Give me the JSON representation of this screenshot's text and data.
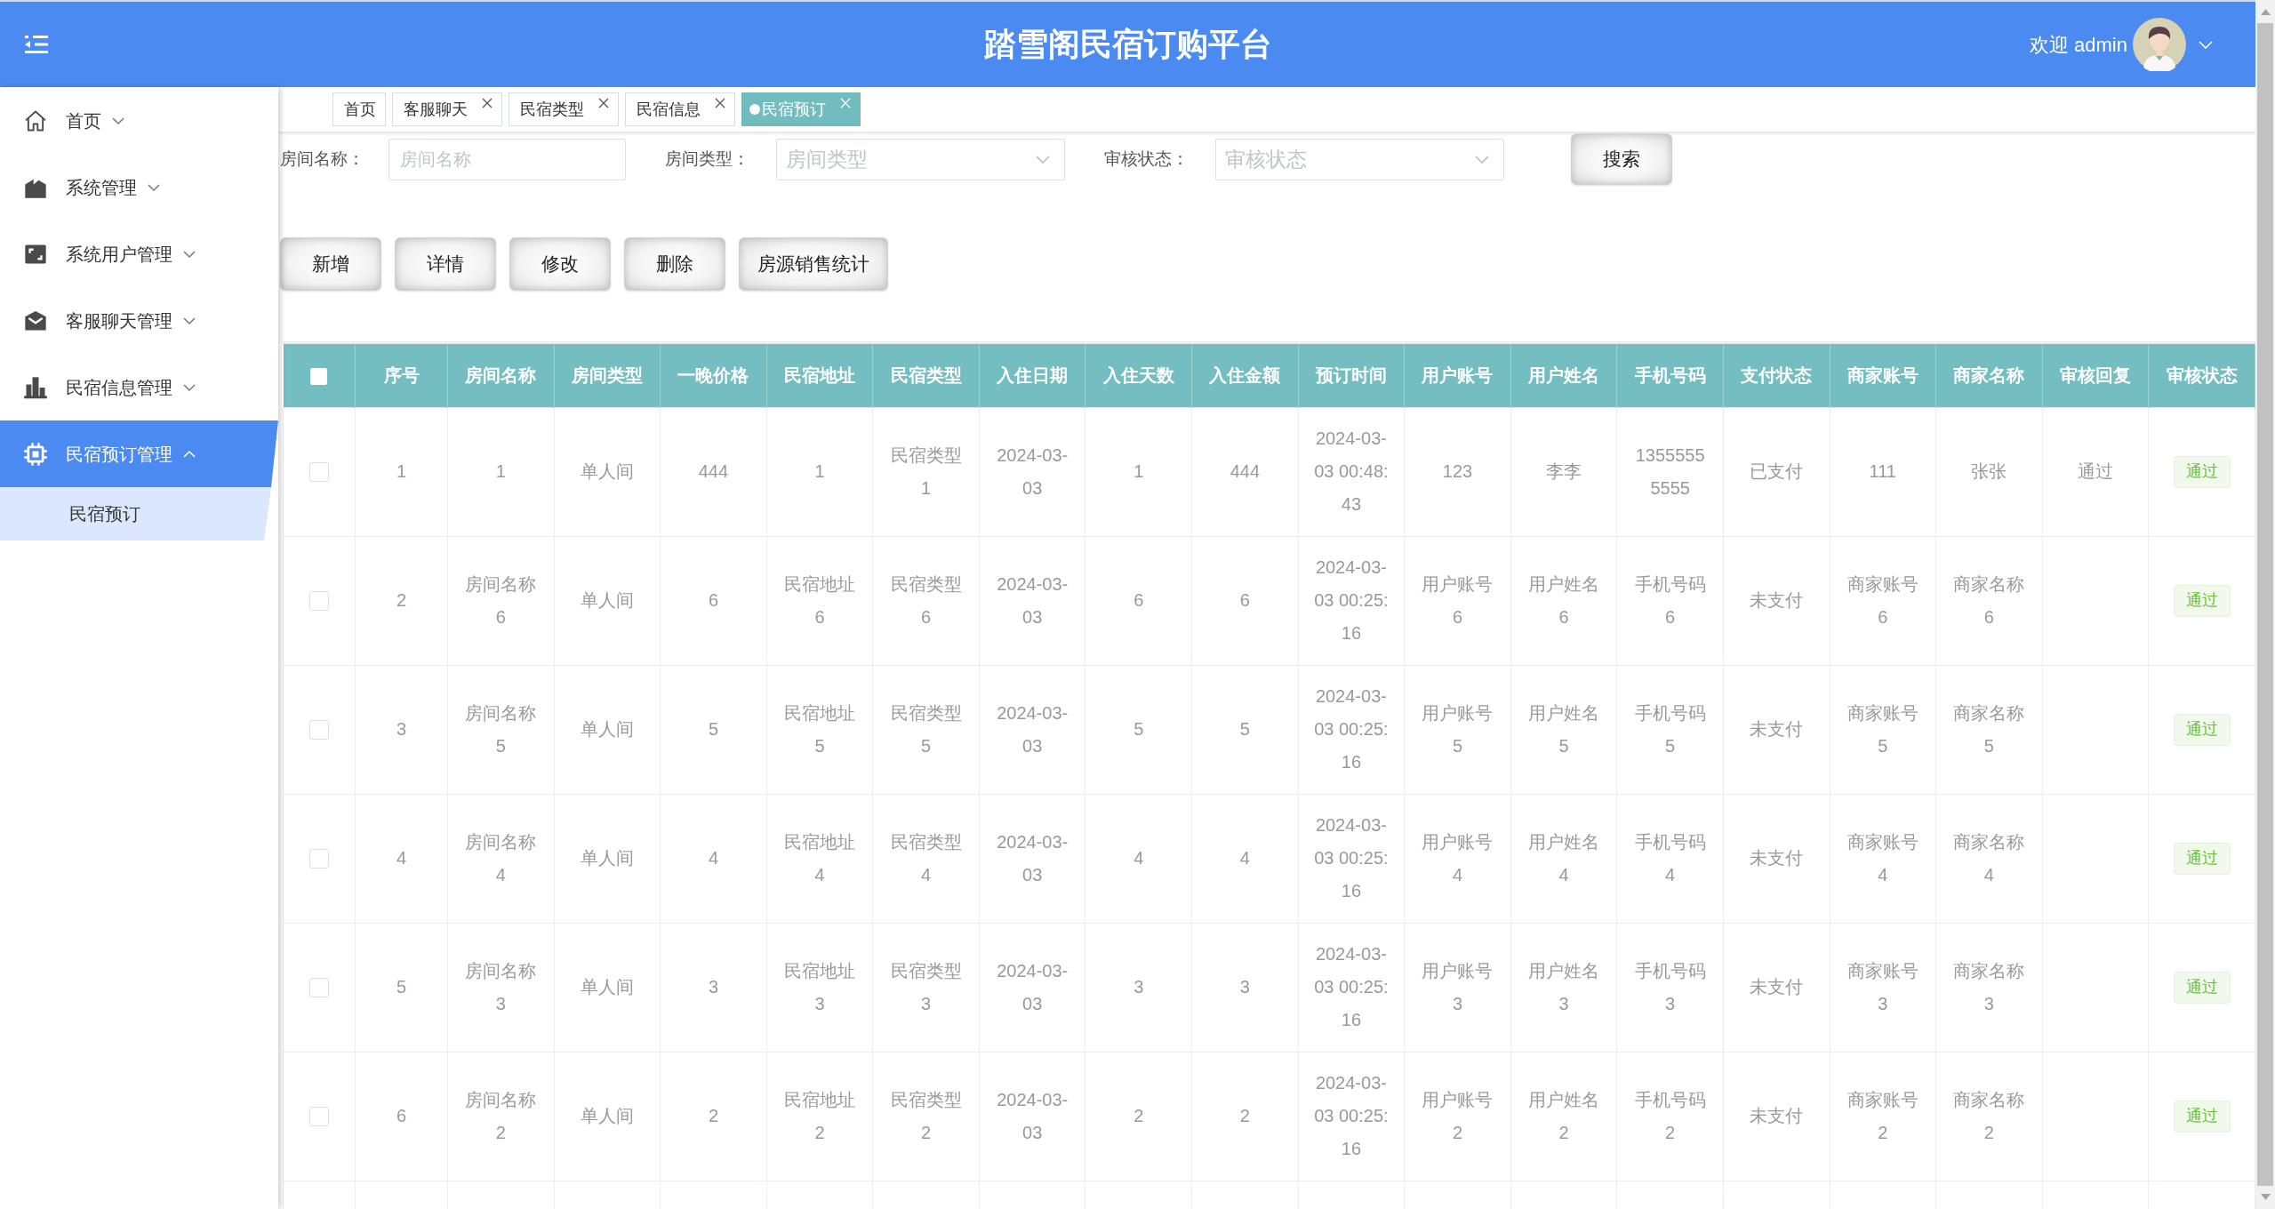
{
  "header": {
    "title": "踏雪阁民宿订购平台",
    "welcome": "欢迎 admin"
  },
  "sidebar": {
    "items": [
      {
        "label": "首页",
        "selected": false,
        "expanded": false
      },
      {
        "label": "系统管理",
        "selected": false,
        "expanded": false
      },
      {
        "label": "系统用户管理",
        "selected": false,
        "expanded": false
      },
      {
        "label": "客服聊天管理",
        "selected": false,
        "expanded": false
      },
      {
        "label": "民宿信息管理",
        "selected": false,
        "expanded": false
      },
      {
        "label": "民宿预订管理",
        "selected": true,
        "expanded": true,
        "children": [
          {
            "label": "民宿预订",
            "selected": true
          }
        ]
      }
    ]
  },
  "tabs": [
    {
      "label": "首页",
      "selected": false,
      "closable": false
    },
    {
      "label": "客服聊天",
      "selected": false,
      "closable": true
    },
    {
      "label": "民宿类型",
      "selected": false,
      "closable": true
    },
    {
      "label": "民宿信息",
      "selected": false,
      "closable": true
    },
    {
      "label": "民宿预订",
      "selected": true,
      "closable": true
    }
  ],
  "search": {
    "fields": [
      {
        "kind": "input",
        "label": "房间名称：",
        "placeholder": "房间名称"
      },
      {
        "kind": "select",
        "label": "房间类型：",
        "placeholder": "房间类型"
      },
      {
        "kind": "select",
        "label": "审核状态：",
        "placeholder": "审核状态"
      }
    ],
    "button": "搜索"
  },
  "actions": [
    "新增",
    "详情",
    "修改",
    "删除",
    "房源销售统计"
  ],
  "table": {
    "select_all": {
      "checked": false
    },
    "columns": [
      {
        "label": "序号",
        "kind": "text"
      },
      {
        "label": "房间名称",
        "kind": "text"
      },
      {
        "label": "房间类型",
        "kind": "text"
      },
      {
        "label": "一晚价格",
        "kind": "text"
      },
      {
        "label": "民宿地址",
        "kind": "text"
      },
      {
        "label": "民宿类型",
        "kind": "text"
      },
      {
        "label": "入住日期",
        "kind": "text"
      },
      {
        "label": "入住天数",
        "kind": "text"
      },
      {
        "label": "入住金额",
        "kind": "text"
      },
      {
        "label": "预订时间",
        "kind": "text"
      },
      {
        "label": "用户账号",
        "kind": "text"
      },
      {
        "label": "用户姓名",
        "kind": "text"
      },
      {
        "label": "手机号码",
        "kind": "text"
      },
      {
        "label": "支付状态",
        "kind": "text"
      },
      {
        "label": "商家账号",
        "kind": "text"
      },
      {
        "label": "商家名称",
        "kind": "text"
      },
      {
        "label": "审核回复",
        "kind": "text"
      },
      {
        "label": "审核状态",
        "kind": "tag"
      }
    ],
    "rows": [
      {
        "checked": false,
        "index": "1",
        "room_name": "1",
        "room_type": "单人间",
        "price": "444",
        "address": "1",
        "homestay_type": "民宿类型1",
        "checkin_date": "2024-03-03",
        "nights": "1",
        "amount": "444",
        "booking_time": "2024-03-03 00:48:43",
        "user_account": "123",
        "user_name": "李李",
        "phone": "13555555555",
        "payment_status": "已支付",
        "merchant_account": "111",
        "merchant_name": "张张",
        "review_reply": "通过",
        "review_status": "通过"
      },
      {
        "checked": false,
        "index": "2",
        "room_name": "房间名称6",
        "room_type": "单人间",
        "price": "6",
        "address": "民宿地址6",
        "homestay_type": "民宿类型6",
        "checkin_date": "2024-03-03",
        "nights": "6",
        "amount": "6",
        "booking_time": "2024-03-03 00:25:16",
        "user_account": "用户账号6",
        "user_name": "用户姓名6",
        "phone": "手机号码6",
        "payment_status": "未支付",
        "merchant_account": "商家账号6",
        "merchant_name": "商家名称6",
        "review_status": "通过"
      },
      {
        "checked": false,
        "index": "3",
        "room_name": "房间名称5",
        "room_type": "单人间",
        "price": "5",
        "address": "民宿地址5",
        "homestay_type": "民宿类型5",
        "checkin_date": "2024-03-03",
        "nights": "5",
        "amount": "5",
        "booking_time": "2024-03-03 00:25:16",
        "user_account": "用户账号5",
        "user_name": "用户姓名5",
        "phone": "手机号码5",
        "payment_status": "未支付",
        "merchant_account": "商家账号5",
        "merchant_name": "商家名称5",
        "review_status": "通过"
      },
      {
        "checked": false,
        "index": "4",
        "room_name": "房间名称4",
        "room_type": "单人间",
        "price": "4",
        "address": "民宿地址4",
        "homestay_type": "民宿类型4",
        "checkin_date": "2024-03-03",
        "nights": "4",
        "amount": "4",
        "booking_time": "2024-03-03 00:25:16",
        "user_account": "用户账号4",
        "user_name": "用户姓名4",
        "phone": "手机号码4",
        "payment_status": "未支付",
        "merchant_account": "商家账号4",
        "merchant_name": "商家名称4",
        "review_status": "通过"
      },
      {
        "checked": false,
        "index": "5",
        "room_name": "房间名称3",
        "room_type": "单人间",
        "price": "3",
        "address": "民宿地址3",
        "homestay_type": "民宿类型3",
        "checkin_date": "2024-03-03",
        "nights": "3",
        "amount": "3",
        "booking_time": "2024-03-03 00:25:16",
        "user_account": "用户账号3",
        "user_name": "用户姓名3",
        "phone": "手机号码3",
        "payment_status": "未支付",
        "merchant_account": "商家账号3",
        "merchant_name": "商家名称3",
        "review_status": "通过"
      },
      {
        "checked": false,
        "index": "6",
        "room_name": "房间名称2",
        "room_type": "单人间",
        "price": "2",
        "address": "民宿地址2",
        "homestay_type": "民宿类型2",
        "checkin_date": "2024-03-03",
        "nights": "2",
        "amount": "2",
        "booking_time": "2024-03-03 00:25:16",
        "user_account": "用户账号2",
        "user_name": "用户姓名2",
        "phone": "手机号码2",
        "payment_status": "未支付",
        "merchant_account": "商家账号2",
        "merchant_name": "商家名称2",
        "review_status": "通过"
      }
    ]
  }
}
